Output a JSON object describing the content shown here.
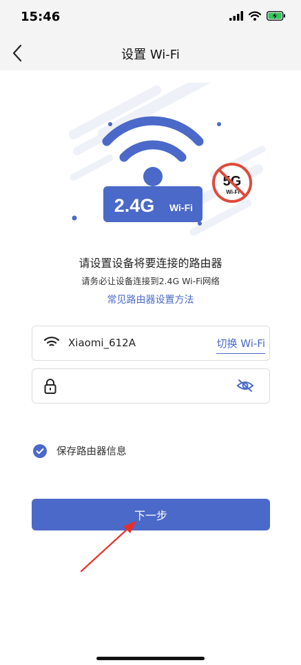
{
  "status_bar": {
    "time": "15:46"
  },
  "nav": {
    "title": "设置 Wi-Fi"
  },
  "hero": {
    "band_label": "2.4G",
    "band_sublabel": "Wi-Fi",
    "blocked_band": "5G",
    "blocked_sublabel": "Wi-Fi"
  },
  "instructions": {
    "headline": "请设置设备将要连接的路由器",
    "subline": "请务必让设备连接到2.4G Wi-Fi网络",
    "help_link": "常见路由器设置方法"
  },
  "wifi_field": {
    "ssid": "Xiaomi_612A",
    "switch_label": "切换 Wi-Fi"
  },
  "password_field": {
    "value": "",
    "placeholder": ""
  },
  "remember": {
    "label": "保存路由器信息",
    "checked": true
  },
  "next_button": {
    "label": "下一步"
  },
  "colors": {
    "accent": "#4a69c8",
    "warning": "#e04a3a",
    "nav_bg": "#f4f4f4"
  }
}
